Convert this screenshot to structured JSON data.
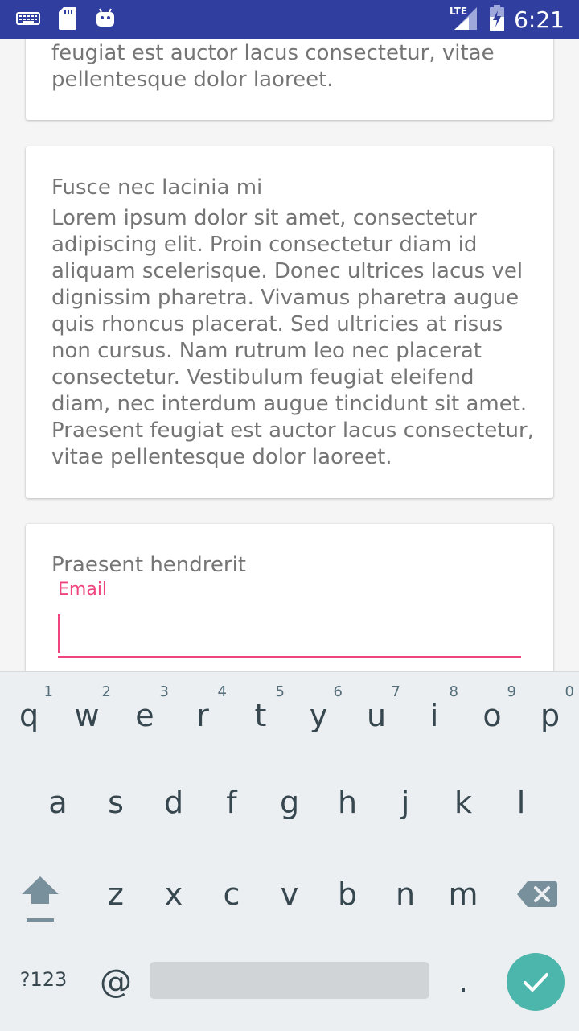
{
  "status_bar": {
    "time": "6:21",
    "network_label": "LTE",
    "left_icons": [
      "keyboard-icon",
      "sd-card-icon",
      "android-icon"
    ],
    "right_icons": [
      "signal-icon",
      "battery-icon"
    ]
  },
  "cards": {
    "first_card_tail": "feugiat est auctor lacus consectetur, vitae pellentesque dolor laoreet.",
    "second_card": {
      "title": "Fusce nec lacinia mi",
      "body": "Lorem ipsum dolor sit amet, consectetur adipiscing elit. Proin consectetur diam id aliquam scelerisque. Donec ultrices lacus vel dignissim pharetra. Vivamus pharetra augue quis rhoncus placerat. Sed ultricies at risus non cursus. Nam rutrum leo nec placerat consectetur. Vestibulum feugiat eleifend diam, nec interdum augue tincidunt sit amet. Praesent feugiat est auctor lacus consectetur, vitae pellentesque dolor laoreet."
    },
    "third_card": {
      "title": "Praesent hendrerit",
      "email_label": "Email",
      "email_value": ""
    }
  },
  "keyboard": {
    "row1": [
      {
        "key": "q",
        "hint": "1"
      },
      {
        "key": "w",
        "hint": "2"
      },
      {
        "key": "e",
        "hint": "3"
      },
      {
        "key": "r",
        "hint": "4"
      },
      {
        "key": "t",
        "hint": "5"
      },
      {
        "key": "y",
        "hint": "6"
      },
      {
        "key": "u",
        "hint": "7"
      },
      {
        "key": "i",
        "hint": "8"
      },
      {
        "key": "o",
        "hint": "9"
      },
      {
        "key": "p",
        "hint": "0"
      }
    ],
    "row2": [
      "a",
      "s",
      "d",
      "f",
      "g",
      "h",
      "j",
      "k",
      "l"
    ],
    "row3": [
      "z",
      "x",
      "c",
      "v",
      "b",
      "n",
      "m"
    ],
    "symbols_label": "?123",
    "at_label": "@",
    "period_label": ".",
    "accent_color": "#4db6ac",
    "input_accent_color": "#f0447e"
  }
}
